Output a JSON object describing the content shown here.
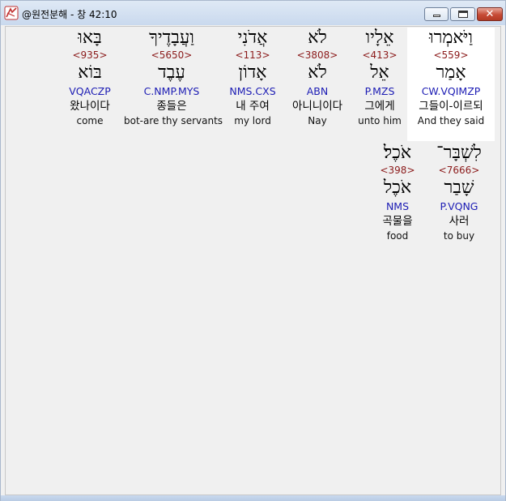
{
  "window": {
    "title": "@원전분해 - 창 42:10",
    "close_glyph": "✕"
  },
  "verse": {
    "row1": [
      {
        "hebrew": "וַיֹּאמְרוּ",
        "strong": "<559>",
        "lemma": "אָמַר",
        "morph": "CW.VQIMZP",
        "korean": "그들이-이르되",
        "english": "And they said",
        "selected": true
      },
      {
        "hebrew": "אֵלָיו",
        "strong": "<413>",
        "lemma": "אֵל",
        "morph": "P.MZS",
        "korean": "그에게",
        "english": "unto him",
        "selected": false
      },
      {
        "hebrew": "לֹא",
        "strong": "<3808>",
        "lemma": "לֹא",
        "morph": "ABN",
        "korean": "아니니이다",
        "english": "Nay",
        "selected": false
      },
      {
        "hebrew": "אֲדֹנִי",
        "strong": "<113>",
        "lemma": "אָדוֹן",
        "morph": "NMS.CXS",
        "korean": "내 주여",
        "english": "my lord",
        "selected": false
      },
      {
        "hebrew": "וַעֲבָדֶיךָ",
        "strong": "<5650>",
        "lemma": "עֶבֶד",
        "morph": "C.NMP.MYS",
        "korean": "종들은",
        "english": "bot-are thy servants",
        "selected": false
      },
      {
        "hebrew": "בָּאוּ",
        "strong": "<935>",
        "lemma": "בּוֹא",
        "morph": "VQACZP",
        "korean": "왔나이다",
        "english": "come",
        "selected": false
      }
    ],
    "row2": [
      {
        "hebrew": "לִשְׁבָּר־",
        "strong": "<7666>",
        "lemma": "שָׁבַר",
        "morph": "P.VQNG",
        "korean": "사러",
        "english": "to buy",
        "selected": false
      },
      {
        "hebrew": "אֹכֶל׃",
        "strong": "<398>",
        "lemma": "אֹכֶל",
        "morph": "NMS",
        "korean": "곡물을",
        "english": "food",
        "selected": false
      }
    ]
  }
}
